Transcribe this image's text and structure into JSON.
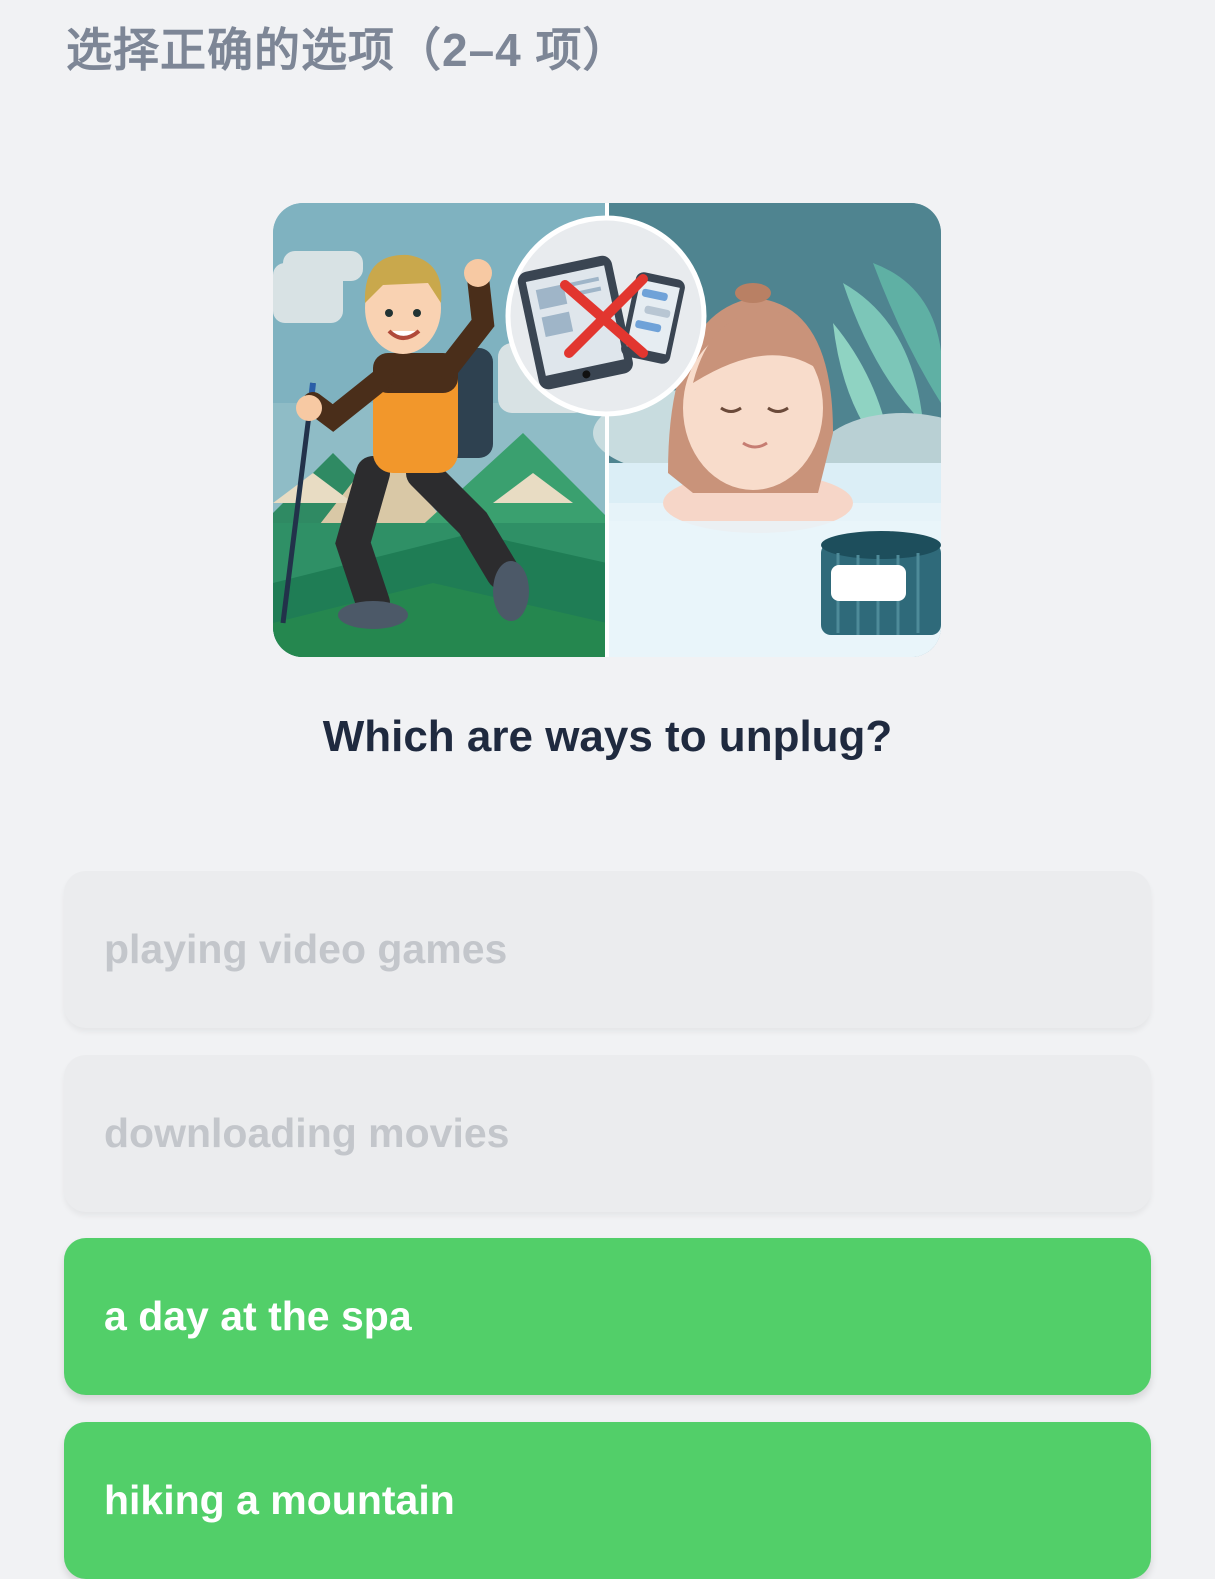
{
  "instruction": "选择正确的选项（2–4 项）",
  "question": "Which are ways to unplug?",
  "illustration": {
    "icon": "no-devices-icon",
    "left_scene": "hiker",
    "right_scene": "spa"
  },
  "options": [
    {
      "label": "playing video games",
      "state": "disabled"
    },
    {
      "label": "downloading movies",
      "state": "disabled"
    },
    {
      "label": "a day at the spa",
      "state": "selected"
    },
    {
      "label": "hiking a mountain",
      "state": "selected"
    }
  ],
  "colors": {
    "background": "#f1f2f4",
    "selected": "#52cf69",
    "disabled_bg": "#ebecee",
    "disabled_text": "#c3c6cb",
    "question": "#1f2a3f",
    "instruction": "#7d8696"
  }
}
